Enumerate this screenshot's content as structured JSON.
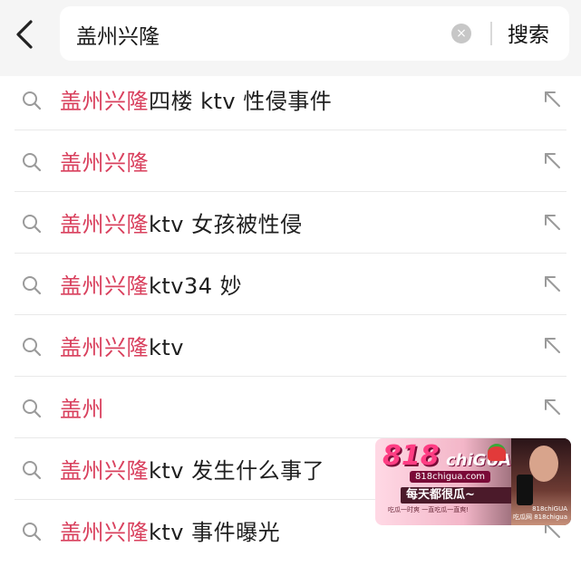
{
  "search": {
    "query": "盖州兴隆",
    "clear_icon": "×",
    "submit_label": "搜索"
  },
  "suggestions": [
    {
      "highlight": "盖州兴隆",
      "rest": "四楼 ktv 性侵事件"
    },
    {
      "highlight": "盖州兴隆",
      "rest": ""
    },
    {
      "highlight": "盖州兴隆",
      "rest": "ktv 女孩被性侵"
    },
    {
      "highlight": "盖州兴隆",
      "rest": "ktv34 妙"
    },
    {
      "highlight": "盖州兴隆",
      "rest": "ktv"
    },
    {
      "highlight": "盖州",
      "rest": ""
    },
    {
      "highlight": "盖州兴隆",
      "rest": "ktv 发生什么事了"
    },
    {
      "highlight": "盖州兴隆",
      "rest": "ktv 事件曝光"
    }
  ],
  "ad": {
    "brand": "818",
    "brand2": "chiGUA",
    "site": "818chigua.com",
    "slogan": "每天都很瓜~",
    "sub": "吃瓜一时爽 一直吃瓜一直爽!",
    "tag": "818chiGUA\n吃瓜网 818chigua"
  },
  "colors": {
    "highlight": "#d9415e",
    "text": "#1f1f1f",
    "topbar": "#f5f5f5"
  }
}
